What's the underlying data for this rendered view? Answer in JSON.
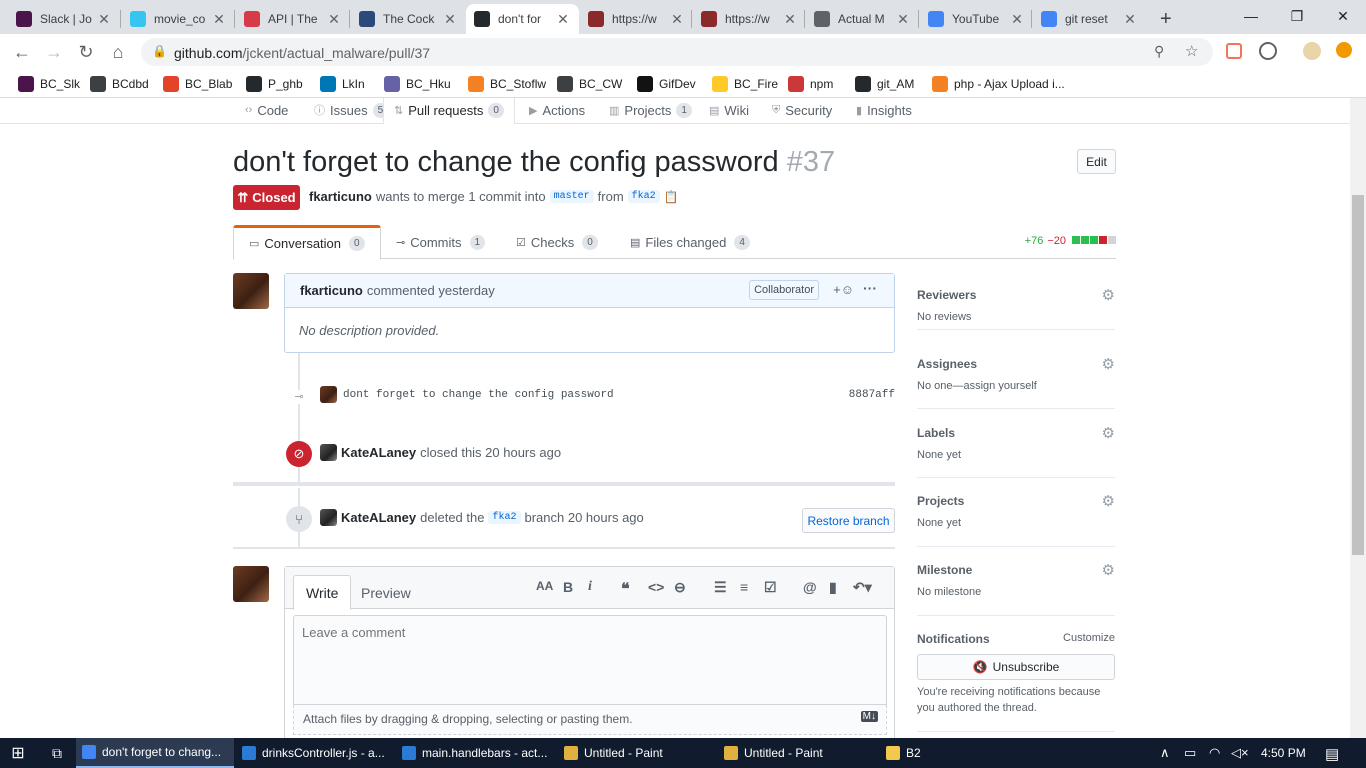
{
  "browser": {
    "tabs": [
      {
        "title": "Slack | Jo",
        "icon": "slack-icon",
        "color": "#4a154b"
      },
      {
        "title": "movie_co",
        "icon": "slack-icon",
        "color": "#36c5f0"
      },
      {
        "title": "API | The",
        "icon": "cocktail-icon",
        "color": "#d73a49"
      },
      {
        "title": "The Cock",
        "icon": "cocktail-icon",
        "color": "#2b4a7a"
      },
      {
        "title": "don't for",
        "icon": "github-icon",
        "color": "#24292e",
        "active": true
      },
      {
        "title": "https://w",
        "icon": "glass-icon",
        "color": "#8a2a2a"
      },
      {
        "title": "https://w",
        "icon": "glass-icon",
        "color": "#8a2a2a"
      },
      {
        "title": "Actual M",
        "icon": "globe-icon",
        "color": "#5f6368"
      },
      {
        "title": "YouTube",
        "icon": "code-icon",
        "color": "#4285f4"
      },
      {
        "title": "git reset",
        "icon": "google-icon",
        "color": "#4285f4"
      }
    ],
    "new_tab_label": "+",
    "url_host": "github.com",
    "url_path": "/jckent/actual_malware/pull/37",
    "bookmarks": [
      {
        "label": "BC_Slk",
        "icon": "slack-icon",
        "color": "#4a154b"
      },
      {
        "label": "BCdbd",
        "icon": "globe-icon",
        "color": "#3c4043"
      },
      {
        "label": "BC_Blab",
        "icon": "gitlab-icon",
        "color": "#e24329"
      },
      {
        "label": "P_ghb",
        "icon": "github-icon",
        "color": "#24292e"
      },
      {
        "label": "LkIn",
        "icon": "linkedin-icon",
        "color": "#0077b5"
      },
      {
        "label": "BC_Hku",
        "icon": "heroku-icon",
        "color": "#6762a6"
      },
      {
        "label": "BC_Stoflw",
        "icon": "stackoverflow-icon",
        "color": "#f48024"
      },
      {
        "label": "BC_CW",
        "icon": "globe-icon",
        "color": "#3c4043"
      },
      {
        "label": "GifDev",
        "icon": "gif-icon",
        "color": "#121212"
      },
      {
        "label": "BC_Fire",
        "icon": "firebase-icon",
        "color": "#ffca28"
      },
      {
        "label": "npm",
        "icon": "npm-icon",
        "color": "#cb3837"
      },
      {
        "label": "git_AM",
        "icon": "github-icon",
        "color": "#24292e"
      },
      {
        "label": "php - Ajax Upload i...",
        "icon": "stackoverflow-icon",
        "color": "#f48024"
      }
    ]
  },
  "repo_nav": [
    {
      "label": "Code",
      "count": ""
    },
    {
      "label": "Issues",
      "count": "5"
    },
    {
      "label": "Pull requests",
      "count": "0",
      "selected": true
    },
    {
      "label": "Actions",
      "count": ""
    },
    {
      "label": "Projects",
      "count": "1"
    },
    {
      "label": "Wiki",
      "count": ""
    },
    {
      "label": "Security",
      "count": ""
    },
    {
      "label": "Insights",
      "count": ""
    }
  ],
  "pr": {
    "title": "don't forget to change the config password",
    "number": "#37",
    "edit_label": "Edit",
    "state": "Closed",
    "author": "fkarticuno",
    "merge_text": "wants to merge 1 commit into",
    "base_branch": "master",
    "from_text": "from",
    "head_branch": "fka2"
  },
  "pr_tabs": [
    {
      "label": "Conversation",
      "count": "0"
    },
    {
      "label": "Commits",
      "count": "1"
    },
    {
      "label": "Checks",
      "count": "0"
    },
    {
      "label": "Files changed",
      "count": "4"
    }
  ],
  "diffstat": {
    "additions": "+76",
    "deletions": "−20",
    "colors": [
      "#2cbe4e",
      "#2cbe4e",
      "#2cbe4e",
      "#cb2431",
      "#d1d5da"
    ]
  },
  "comment": {
    "author": "fkarticuno",
    "action": "commented yesterday",
    "role": "Collaborator",
    "body": "No description provided."
  },
  "commit": {
    "message": "dont forget to change the config password",
    "sha": "8887aff"
  },
  "events": {
    "closed": {
      "actor": "KateALaney",
      "text": "closed this 20 hours ago"
    },
    "deleted": {
      "actor": "KateALaney",
      "text_before": "deleted the",
      "branch": "fka2",
      "text_after": "branch 20 hours ago",
      "button": "Restore branch"
    }
  },
  "compose": {
    "tab_write": "Write",
    "tab_preview": "Preview",
    "placeholder": "Leave a comment",
    "attach_text": "Attach files by dragging & dropping, selecting or pasting them."
  },
  "sidebar": {
    "reviewers": {
      "heading": "Reviewers",
      "value": "No reviews"
    },
    "assignees": {
      "heading": "Assignees",
      "value": "No one—assign yourself"
    },
    "labels": {
      "heading": "Labels",
      "value": "None yet"
    },
    "projects": {
      "heading": "Projects",
      "value": "None yet"
    },
    "milestone": {
      "heading": "Milestone",
      "value": "No milestone"
    },
    "notifications": {
      "heading": "Notifications",
      "customize": "Customize",
      "button": "Unsubscribe",
      "reason": "You're receiving notifications because you authored the thread."
    }
  },
  "taskbar": {
    "items": [
      {
        "label": "don't forget to chang...",
        "active": true,
        "color": "#4285f4"
      },
      {
        "label": "drinksController.js - a...",
        "color": "#2a7bd6"
      },
      {
        "label": "main.handlebars - act...",
        "color": "#2a7bd6"
      },
      {
        "label": "Untitled - Paint",
        "color": "#e0b040"
      },
      {
        "label": "Untitled - Paint",
        "color": "#e0b040"
      },
      {
        "label": "B2",
        "color": "#f2c94c"
      }
    ],
    "time": "4:50 PM"
  }
}
